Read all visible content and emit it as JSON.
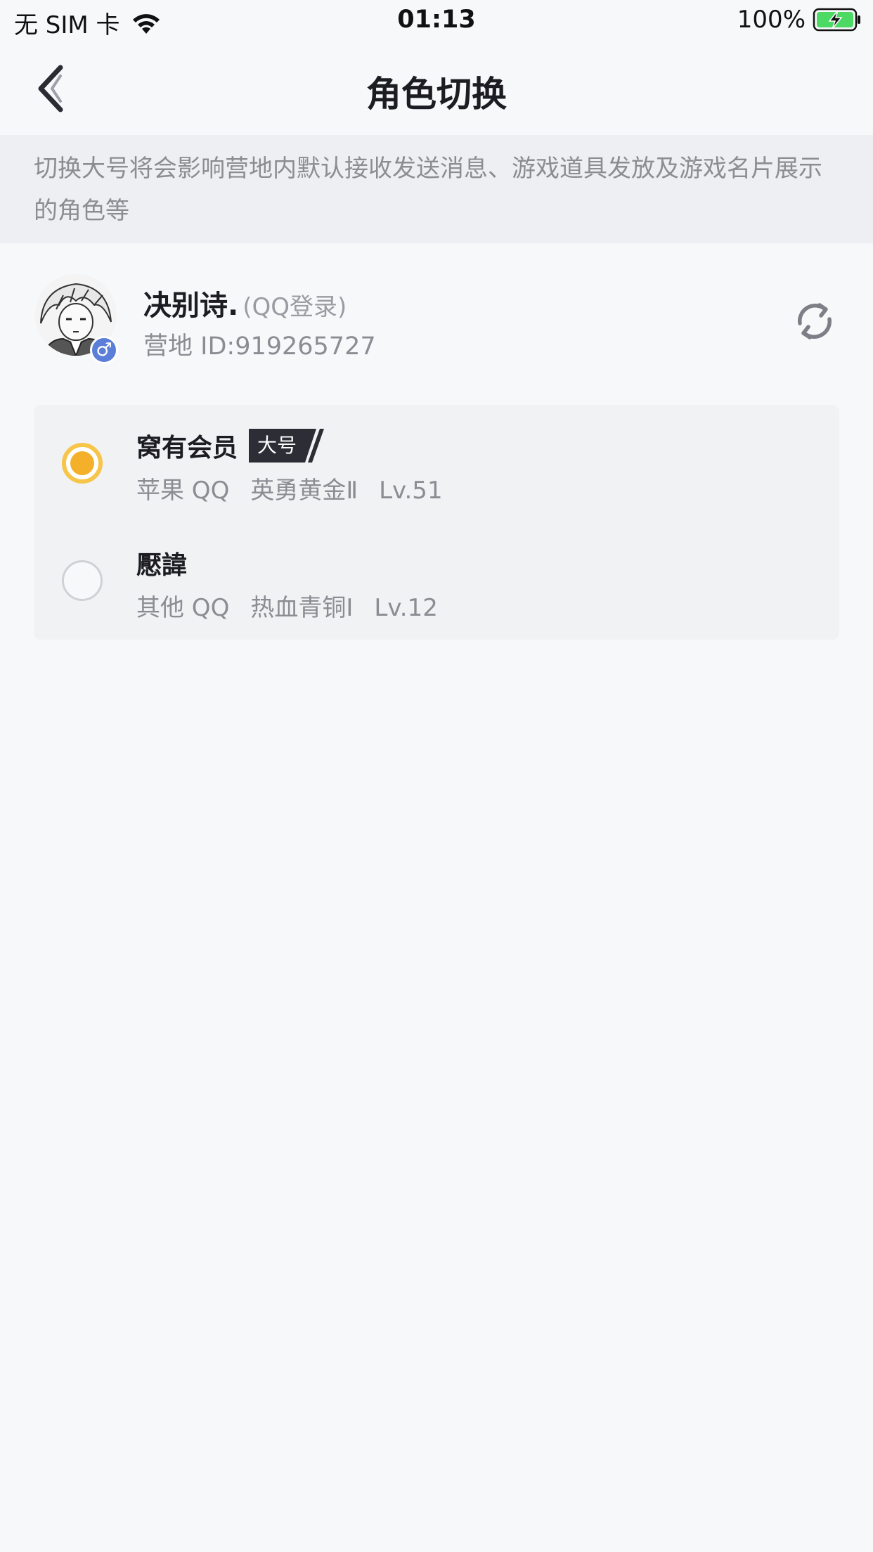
{
  "status_bar": {
    "carrier": "无 SIM 卡",
    "time": "01:13",
    "battery_percent": "100%",
    "battery_charging": true,
    "battery_color": "#4cd964"
  },
  "nav": {
    "title": "角色切换",
    "back_icon": "chevron-left-icon"
  },
  "notice": {
    "text": "切换大号将会影响营地内默认接收发送消息、游戏道具发放及游戏名片展示的角色等"
  },
  "account": {
    "name": "决别诗.",
    "login_type": "(QQ登录)",
    "camp_id": "营地 ID:919265727",
    "gender_icon": "male-icon",
    "gender_color": "#5b7fd8",
    "refresh_icon": "refresh-icon"
  },
  "roles": [
    {
      "name": "窝有会员",
      "tag": "大号",
      "platform": "苹果 QQ",
      "rank": "英勇黄金Ⅱ",
      "level": "Lv.51",
      "selected": true
    },
    {
      "name": "懕諱",
      "tag": "",
      "platform": "其他 QQ",
      "rank": "热血青铜Ⅰ",
      "level": "Lv.12",
      "selected": false
    }
  ],
  "colors": {
    "background": "#f7f8fa",
    "selected_radio": "#f5b02a",
    "tag_background": "#2c2d35"
  }
}
